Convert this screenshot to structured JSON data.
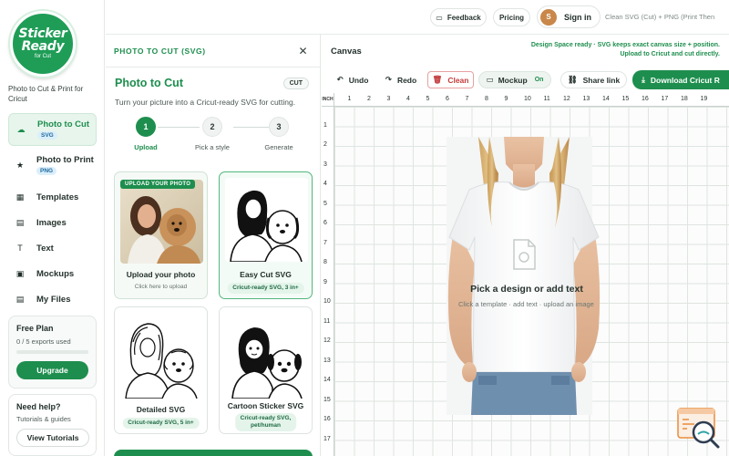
{
  "brand": {
    "logo_line1": "Sticker",
    "logo_line2": "Ready",
    "logo_line3": "for Cut",
    "tagline": "Photo to Cut & Print for Cricut"
  },
  "sidebar": {
    "items": [
      {
        "label": "Photo to Cut",
        "badge": "SVG",
        "icon": "cut-icon",
        "glyph": "☁",
        "active": true
      },
      {
        "label": "Photo to Print",
        "badge": "PNG",
        "icon": "star-icon",
        "glyph": "★",
        "active": false
      },
      {
        "label": "Templates",
        "icon": "templates-icon",
        "glyph": "▦"
      },
      {
        "label": "Images",
        "icon": "images-icon",
        "glyph": "▤"
      },
      {
        "label": "Text",
        "icon": "text-icon",
        "glyph": "T"
      },
      {
        "label": "Mockups",
        "icon": "mockups-icon",
        "glyph": "▣"
      },
      {
        "label": "My Files",
        "icon": "files-icon",
        "glyph": "▤"
      }
    ],
    "plan": {
      "title": "Free Plan",
      "exports": "0 / 5 exports used",
      "upgrade": "Upgrade",
      "used_fraction": 0
    },
    "help": {
      "title": "Need help?",
      "subtitle": "Tutorials & guides",
      "button": "View Tutorials"
    }
  },
  "topbar": {
    "feedback": "Feedback",
    "pricing": "Pricing",
    "avatar_initial": "S",
    "signin": "Sign in",
    "breadcrumb": "Clean SVG (Cut) + PNG (Print Then"
  },
  "panel": {
    "header": "PHOTO TO CUT (SVG)",
    "title": "Photo to Cut",
    "badge": "CUT",
    "subtitle": "Turn your picture into a Cricut-ready SVG for cutting.",
    "steps": [
      {
        "num": "1",
        "label": "Upload",
        "active": true
      },
      {
        "num": "2",
        "label": "Pick a style",
        "active": false
      },
      {
        "num": "3",
        "label": "Generate",
        "active": false
      }
    ],
    "cards": [
      {
        "tag": "UPLOAD YOUR PHOTO",
        "title": "Upload your photo",
        "caption": "Click here to upload"
      },
      {
        "title": "Easy Cut SVG",
        "pill": "Cricut-ready SVG, 3 in+",
        "selected": true
      },
      {
        "title": "Detailed SVG",
        "pill": "Cricut-ready SVG, 5 in+"
      },
      {
        "title": "Cartoon Sticker SVG",
        "pill_line1": "Cricut-ready SVG,",
        "pill_line2": "pet/human"
      }
    ]
  },
  "canvas": {
    "title": "Canvas",
    "note_line1": "Design Space ready · SVG keeps exact canvas size + position.",
    "note_line2": "Upload to Cricut and cut directly.",
    "tools": {
      "undo": "Undo",
      "redo": "Redo",
      "clean": "Clean",
      "mockup": "Mockup",
      "mockup_state": "On",
      "share": "Share link",
      "download": "Download Cricut R"
    },
    "ruler_unit": "INCH",
    "ruler_top": [
      "1",
      "2",
      "3",
      "4",
      "5",
      "6",
      "7",
      "8",
      "9",
      "10",
      "11",
      "12",
      "13",
      "14",
      "15",
      "16",
      "17",
      "18",
      "19"
    ],
    "ruler_left": [
      "1",
      "2",
      "3",
      "4",
      "5",
      "6",
      "7",
      "8",
      "9",
      "10",
      "11",
      "12",
      "13",
      "14",
      "15",
      "16",
      "17"
    ],
    "empty_title": "Pick a design or add text",
    "empty_sub": "Click a template · add text · upload an image"
  },
  "colors": {
    "brand_green": "#1e8e4e",
    "accent_red": "#c33a3a",
    "badge_blue": "#dbeefb"
  }
}
